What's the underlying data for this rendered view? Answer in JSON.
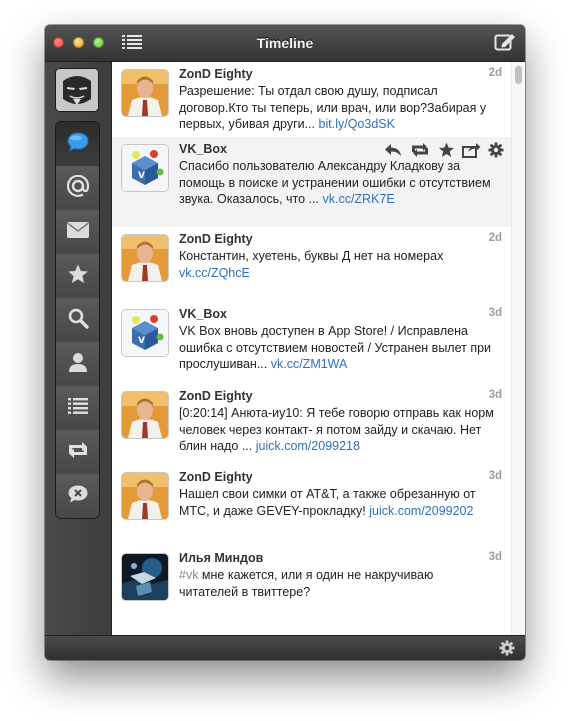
{
  "window": {
    "title": "Timeline"
  },
  "tweets": [
    {
      "author": "ZonD Eighty",
      "time": "2d",
      "text": "Разрешение: Ты отдал свою душу, подписал договор.Кто ты теперь, или врач, или вор?Забирая у первых, убивая други... ",
      "link": "bit.ly/Qo3dSK"
    },
    {
      "author": "VK_Box",
      "time": "",
      "text": "Спасибо пользователю Александру Кладкову за помощь в поиске и устранении ошибки с отсутствием звука. Оказалось, что ... ",
      "link": "vk.cc/ZRK7E"
    },
    {
      "author": "ZonD Eighty",
      "time": "2d",
      "text": "Константин, хуетень, буквы Д нет на номерах ",
      "link": "vk.cc/ZQhcE"
    },
    {
      "author": "VK_Box",
      "time": "3d",
      "text": "VK Box вновь доступен в App Store! / Исправлена ошибка с отсутствием новостей / Устранен вылет при прослушиван... ",
      "link": "vk.cc/ZM1WA"
    },
    {
      "author": "ZonD Eighty",
      "time": "3d",
      "text": "[0:20:14] Анюта-иу10: Я тебе говорю отправь как норм человек через контакт- я потом зайду и скачаю. Нет блин надо ... ",
      "link": "juick.com/2099218"
    },
    {
      "author": "ZonD Eighty",
      "time": "3d",
      "text": "Нашел свои симки от AT&T, а также обрезанную от МТС, и даже GEVEY-прокладку! ",
      "link": "juick.com/2099202"
    },
    {
      "author": "Илья Миндов",
      "time": "3d",
      "hashtag": "#vk",
      "text": " мне кажется, или я один не накручиваю читателей в твиттере?"
    }
  ],
  "icons": {
    "sidebar": [
      "timeline-icon",
      "mentions-icon",
      "messages-icon",
      "favorites-icon",
      "search-icon",
      "profile-icon",
      "lists-icon",
      "retweets-icon",
      "muted-icon"
    ],
    "tweet_actions": [
      "reply-icon",
      "retweet-icon",
      "favorite-icon",
      "share-icon",
      "settings-icon"
    ],
    "accent": "#2e6fc0"
  }
}
